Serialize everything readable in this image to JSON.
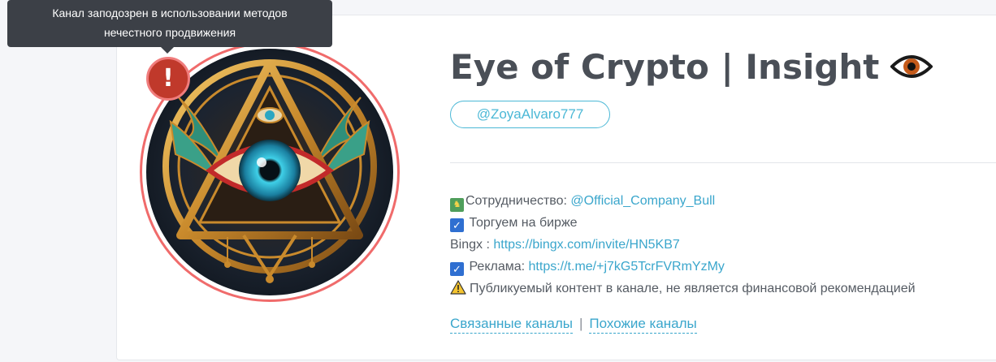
{
  "tooltip": {
    "line1": "Канал заподозрен в использовании методов",
    "line2": "нечестного продвижения"
  },
  "alert_badge": "!",
  "channel": {
    "title": "Eye of Crypto | Insight",
    "title_icon": "eye-icon",
    "handle": "@ZoyaAlvaro777"
  },
  "description": {
    "collab_label": "Сотрудничество: ",
    "collab_link": "@Official_Company_Bull",
    "trade": "Торгуем на бирже",
    "bingx_label": "Bingx : ",
    "bingx_link": "https://bingx.com/invite/HN5KB7",
    "ads_label": "Реклама: ",
    "ads_link": "https://t.me/+j7kG5TcrFVRmYzMy",
    "disclaimer": "Публикуемый контент в канале, не является финансовой рекомендацией"
  },
  "related": {
    "related_label": "Связанные каналы",
    "separator": "|",
    "similar_label": "Похожие каналы"
  },
  "colors": {
    "accent": "#3aa6cc",
    "alert": "#c0392b",
    "ring": "#f06b6b",
    "tooltip_bg": "#3c4047"
  }
}
